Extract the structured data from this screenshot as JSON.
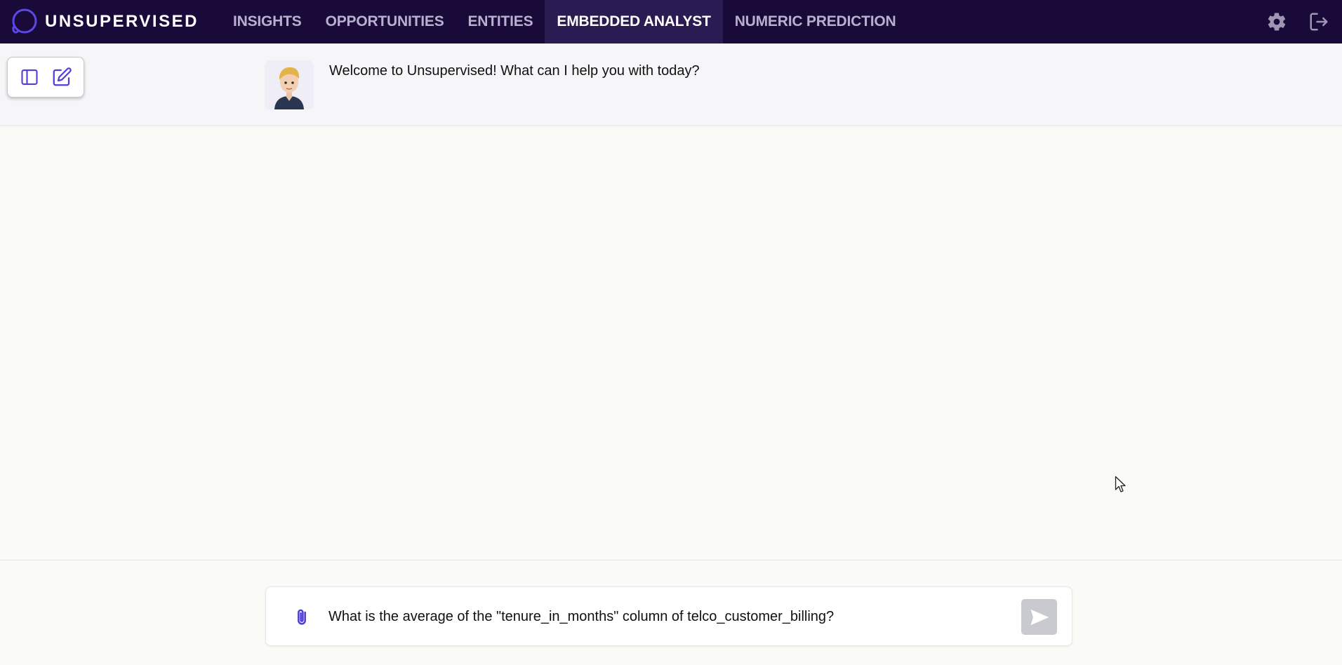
{
  "brand": {
    "name": "UNSUPERVISED",
    "accent": "#4f3fd6"
  },
  "nav": {
    "items": [
      {
        "label": "INSIGHTS",
        "active": false
      },
      {
        "label": "OPPORTUNITIES",
        "active": false
      },
      {
        "label": "ENTITIES",
        "active": false
      },
      {
        "label": "EMBEDDED ANALYST",
        "active": true
      },
      {
        "label": "NUMERIC PREDICTION",
        "active": false
      }
    ]
  },
  "topbar_icons": [
    "gear-icon",
    "logout-icon"
  ],
  "sidebar_controls": [
    "sidebar-toggle-icon",
    "new-chat-icon"
  ],
  "chat": {
    "welcome_message": "Welcome to Unsupervised! What can I help you with today?"
  },
  "composer": {
    "input_value": "What is the average of the \"tenure_in_months\" column of telco_customer_billing?",
    "send_enabled": false
  },
  "colors": {
    "topbar_bg": "#1a0a3a",
    "icon_purple": "#4f3fd6",
    "page_bg": "#fafaf7"
  }
}
